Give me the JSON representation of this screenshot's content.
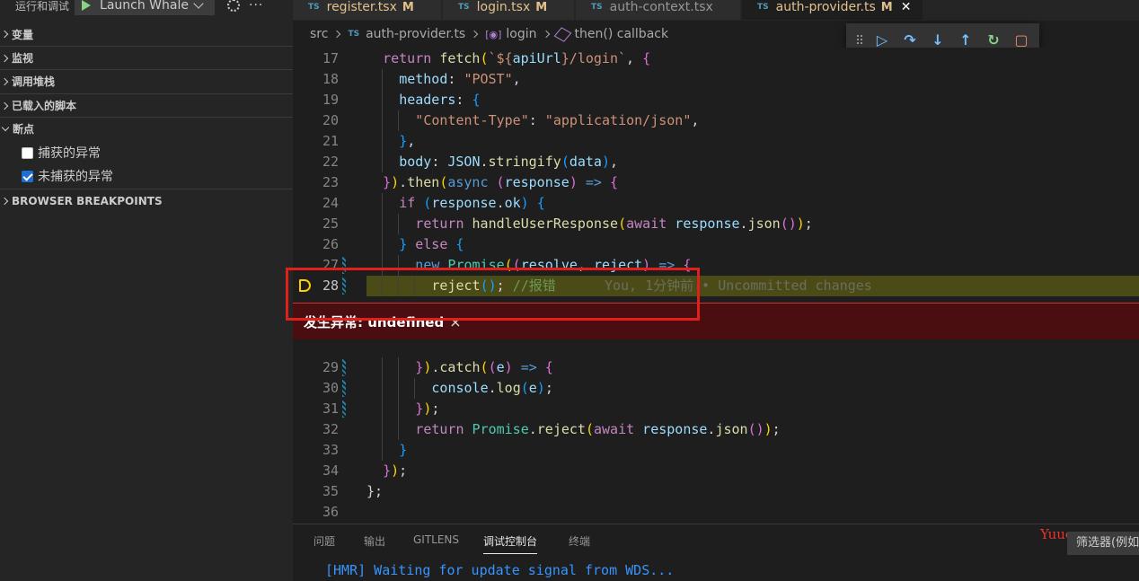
{
  "sidebar": {
    "title": "运行和调试",
    "launch_config": "Launch Whale",
    "sections": [
      {
        "label": "变量"
      },
      {
        "label": "监视"
      },
      {
        "label": "调用堆栈"
      },
      {
        "label": "已载入的脚本"
      },
      {
        "label": "断点"
      },
      {
        "label": "BROWSER BREAKPOINTS"
      }
    ],
    "breakpoints": [
      {
        "label": "捕获的异常",
        "checked": false
      },
      {
        "label": "未捕获的异常",
        "checked": true
      }
    ]
  },
  "tabs": [
    {
      "label": "register.tsx",
      "modified": "M"
    },
    {
      "label": "login.tsx",
      "modified": "M"
    },
    {
      "label": "auth-context.tsx",
      "modified": ""
    },
    {
      "label": "auth-provider.ts",
      "modified": "M",
      "active": true
    }
  ],
  "ts_badge": "TS",
  "breadcrumb": {
    "root": "src",
    "file": "auth-provider.ts",
    "symbol": "login",
    "callback": "then() callback"
  },
  "code_lines": [
    {
      "n": "17",
      "tokens": [
        [
          "kw",
          "return "
        ],
        [
          "fn",
          "fetch"
        ],
        [
          "br1",
          "("
        ],
        [
          "str",
          "`${"
        ],
        [
          "vr",
          "apiUrl"
        ],
        [
          "str",
          "}/login`"
        ],
        [
          "pn",
          ", "
        ],
        [
          "br2",
          "{"
        ]
      ]
    },
    {
      "n": "18",
      "tokens": [
        [
          "vr",
          "method"
        ],
        [
          "pn",
          ": "
        ],
        [
          "str",
          "\"POST\""
        ],
        [
          "pn",
          ","
        ]
      ]
    },
    {
      "n": "19",
      "tokens": [
        [
          "vr",
          "headers"
        ],
        [
          "pn",
          ": "
        ],
        [
          "br3",
          "{"
        ]
      ]
    },
    {
      "n": "20",
      "tokens": [
        [
          "str",
          "\"Content-Type\""
        ],
        [
          "pn",
          ": "
        ],
        [
          "str",
          "\"application/json\""
        ],
        [
          "pn",
          ","
        ]
      ]
    },
    {
      "n": "21",
      "tokens": [
        [
          "br3",
          "}"
        ],
        [
          "pn",
          ","
        ]
      ]
    },
    {
      "n": "22",
      "tokens": [
        [
          "vr",
          "body"
        ],
        [
          "pn",
          ": "
        ],
        [
          "vr",
          "JSON"
        ],
        [
          "pn",
          "."
        ],
        [
          "fn",
          "stringify"
        ],
        [
          "br3",
          "("
        ],
        [
          "vr",
          "data"
        ],
        [
          "br3",
          ")"
        ],
        [
          "pn",
          ","
        ]
      ]
    },
    {
      "n": "23",
      "tokens": [
        [
          "br2",
          "}"
        ],
        [
          "br1",
          ")"
        ],
        [
          "pn",
          "."
        ],
        [
          "fn",
          "then"
        ],
        [
          "br1",
          "("
        ],
        [
          "kwb",
          "async "
        ],
        [
          "br2",
          "("
        ],
        [
          "vr",
          "response"
        ],
        [
          "br2",
          ")"
        ],
        [
          "kwb",
          " => "
        ],
        [
          "br2",
          "{"
        ]
      ]
    },
    {
      "n": "24",
      "tokens": [
        [
          "kw",
          "if "
        ],
        [
          "br3",
          "("
        ],
        [
          "vr",
          "response"
        ],
        [
          "pn",
          "."
        ],
        [
          "vr",
          "ok"
        ],
        [
          "br3",
          ")"
        ],
        [
          "pn",
          " "
        ],
        [
          "br3",
          "{"
        ]
      ]
    },
    {
      "n": "25",
      "tokens": [
        [
          "kw",
          "return "
        ],
        [
          "fn",
          "handleUserResponse"
        ],
        [
          "br1",
          "("
        ],
        [
          "kw",
          "await "
        ],
        [
          "vr",
          "response"
        ],
        [
          "pn",
          "."
        ],
        [
          "fn",
          "json"
        ],
        [
          "br2",
          "()"
        ],
        [
          "br1",
          ")"
        ],
        [
          "pn",
          ";"
        ]
      ]
    },
    {
      "n": "26",
      "tokens": [
        [
          "br3",
          "}"
        ],
        [
          "kw",
          " else "
        ],
        [
          "br3",
          "{"
        ]
      ]
    },
    {
      "n": "27",
      "tokens": [
        [
          "kwb",
          "new "
        ],
        [
          "ty",
          "Promise"
        ],
        [
          "br1",
          "("
        ],
        [
          "br2",
          "("
        ],
        [
          "vr",
          "resolve"
        ],
        [
          "pn",
          ", "
        ],
        [
          "vr",
          "reject"
        ],
        [
          "br2",
          ")"
        ],
        [
          "kwb",
          " => "
        ],
        [
          "br2",
          "{"
        ]
      ]
    },
    {
      "n": "28",
      "tokens": [
        [
          "fn",
          "reject"
        ],
        [
          "br3",
          "()"
        ],
        [
          "pn",
          "; "
        ],
        [
          "cm",
          "//报错"
        ]
      ],
      "blame": "You, 1分钟前 • Uncommitted changes"
    },
    {
      "n": "29",
      "tokens": [
        [
          "br2",
          "}"
        ],
        [
          "br1",
          ")"
        ],
        [
          "pn",
          "."
        ],
        [
          "fn",
          "catch"
        ],
        [
          "br1",
          "("
        ],
        [
          "br2",
          "("
        ],
        [
          "vr",
          "e"
        ],
        [
          "br2",
          ")"
        ],
        [
          "kwb",
          " => "
        ],
        [
          "br2",
          "{"
        ]
      ]
    },
    {
      "n": "30",
      "tokens": [
        [
          "vr",
          "console"
        ],
        [
          "pn",
          "."
        ],
        [
          "fn",
          "log"
        ],
        [
          "br3",
          "("
        ],
        [
          "vr",
          "e"
        ],
        [
          "br3",
          ")"
        ],
        [
          "pn",
          ";"
        ]
      ]
    },
    {
      "n": "31",
      "tokens": [
        [
          "br2",
          "}"
        ],
        [
          "br1",
          ")"
        ],
        [
          "pn",
          ";"
        ]
      ]
    },
    {
      "n": "32",
      "tokens": [
        [
          "kw",
          "return "
        ],
        [
          "ty",
          "Promise"
        ],
        [
          "pn",
          "."
        ],
        [
          "fn",
          "reject"
        ],
        [
          "br1",
          "("
        ],
        [
          "kw",
          "await "
        ],
        [
          "vr",
          "response"
        ],
        [
          "pn",
          "."
        ],
        [
          "fn",
          "json"
        ],
        [
          "br2",
          "()"
        ],
        [
          "br1",
          ")"
        ],
        [
          "pn",
          ";"
        ]
      ]
    },
    {
      "n": "33",
      "tokens": [
        [
          "br3",
          "}"
        ]
      ]
    },
    {
      "n": "34",
      "tokens": [
        [
          "br2",
          "}"
        ],
        [
          "br1",
          ")"
        ],
        [
          "pn",
          ";"
        ]
      ]
    },
    {
      "n": "35",
      "tokens": [
        [
          "pn",
          "};"
        ]
      ]
    },
    {
      "n": "36",
      "tokens": []
    }
  ],
  "exception": {
    "message": "发生异常: undefined",
    "close": "×"
  },
  "panel": {
    "tabs": [
      "问题",
      "输出",
      "GITLENS",
      "调试控制台",
      "终端"
    ],
    "active_tab": "调试控制台",
    "filter_placeholder": "筛选器(例如",
    "console_output": "[HMR] Waiting for update signal from WDS...",
    "watermark": "Yuucn.com"
  },
  "colors": {
    "accent_red": "#e0201b",
    "exception_bg": "#4a0d10",
    "breakpoint_yellow": "#ffcc00"
  }
}
